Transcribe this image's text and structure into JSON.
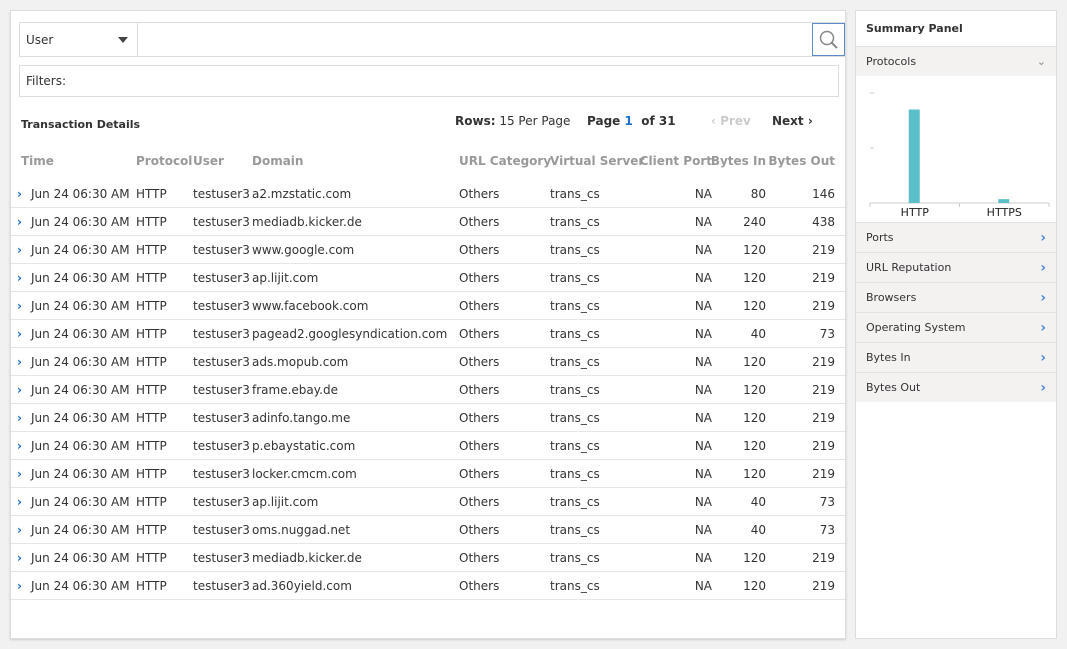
{
  "search": {
    "field": "User",
    "value": "",
    "filters_label": "Filters:"
  },
  "title": "Transaction Details",
  "pager": {
    "rows_label": "Rows:",
    "rows_value": "15 Per Page",
    "page_label": "Page",
    "page": "1",
    "of": "of 31",
    "prev": "Prev",
    "next": "Next"
  },
  "columns": [
    "Time",
    "Protocol",
    "User",
    "Domain",
    "URL Category",
    "Virtual Server",
    "Client Port",
    "Bytes In",
    "Bytes Out"
  ],
  "rows": [
    [
      "Jun 24 06:30 AM",
      "HTTP",
      "testuser3",
      "a2.mzstatic.com",
      "Others",
      "trans_cs",
      "NA",
      "80",
      "146"
    ],
    [
      "Jun 24 06:30 AM",
      "HTTP",
      "testuser3",
      "mediadb.kicker.de",
      "Others",
      "trans_cs",
      "NA",
      "240",
      "438"
    ],
    [
      "Jun 24 06:30 AM",
      "HTTP",
      "testuser3",
      "www.google.com",
      "Others",
      "trans_cs",
      "NA",
      "120",
      "219"
    ],
    [
      "Jun 24 06:30 AM",
      "HTTP",
      "testuser3",
      "ap.lijit.com",
      "Others",
      "trans_cs",
      "NA",
      "120",
      "219"
    ],
    [
      "Jun 24 06:30 AM",
      "HTTP",
      "testuser3",
      "www.facebook.com",
      "Others",
      "trans_cs",
      "NA",
      "120",
      "219"
    ],
    [
      "Jun 24 06:30 AM",
      "HTTP",
      "testuser3",
      "pagead2.googlesyndication.com",
      "Others",
      "trans_cs",
      "NA",
      "40",
      "73"
    ],
    [
      "Jun 24 06:30 AM",
      "HTTP",
      "testuser3",
      "ads.mopub.com",
      "Others",
      "trans_cs",
      "NA",
      "120",
      "219"
    ],
    [
      "Jun 24 06:30 AM",
      "HTTP",
      "testuser3",
      "frame.ebay.de",
      "Others",
      "trans_cs",
      "NA",
      "120",
      "219"
    ],
    [
      "Jun 24 06:30 AM",
      "HTTP",
      "testuser3",
      "adinfo.tango.me",
      "Others",
      "trans_cs",
      "NA",
      "120",
      "219"
    ],
    [
      "Jun 24 06:30 AM",
      "HTTP",
      "testuser3",
      "p.ebaystatic.com",
      "Others",
      "trans_cs",
      "NA",
      "120",
      "219"
    ],
    [
      "Jun 24 06:30 AM",
      "HTTP",
      "testuser3",
      "locker.cmcm.com",
      "Others",
      "trans_cs",
      "NA",
      "120",
      "219"
    ],
    [
      "Jun 24 06:30 AM",
      "HTTP",
      "testuser3",
      "ap.lijit.com",
      "Others",
      "trans_cs",
      "NA",
      "40",
      "73"
    ],
    [
      "Jun 24 06:30 AM",
      "HTTP",
      "testuser3",
      "oms.nuggad.net",
      "Others",
      "trans_cs",
      "NA",
      "40",
      "73"
    ],
    [
      "Jun 24 06:30 AM",
      "HTTP",
      "testuser3",
      "mediadb.kicker.de",
      "Others",
      "trans_cs",
      "NA",
      "120",
      "219"
    ],
    [
      "Jun 24 06:30 AM",
      "HTTP",
      "testuser3",
      "ad.360yield.com",
      "Others",
      "trans_cs",
      "NA",
      "120",
      "219"
    ]
  ],
  "summary": {
    "title": "Summary Panel",
    "expanded": "Protocols",
    "sections": [
      "Ports",
      "URL Reputation",
      "Browsers",
      "Operating System",
      "Bytes In",
      "Bytes Out"
    ]
  },
  "chart_data": {
    "type": "bar",
    "categories": [
      "HTTP",
      "HTTPS"
    ],
    "values": [
      1.7,
      0.07
    ],
    "ylim": [
      0,
      2
    ],
    "color": "#5bbfca"
  },
  "colors": {
    "accent": "#1a73c9",
    "bar": "#5bbfca"
  }
}
